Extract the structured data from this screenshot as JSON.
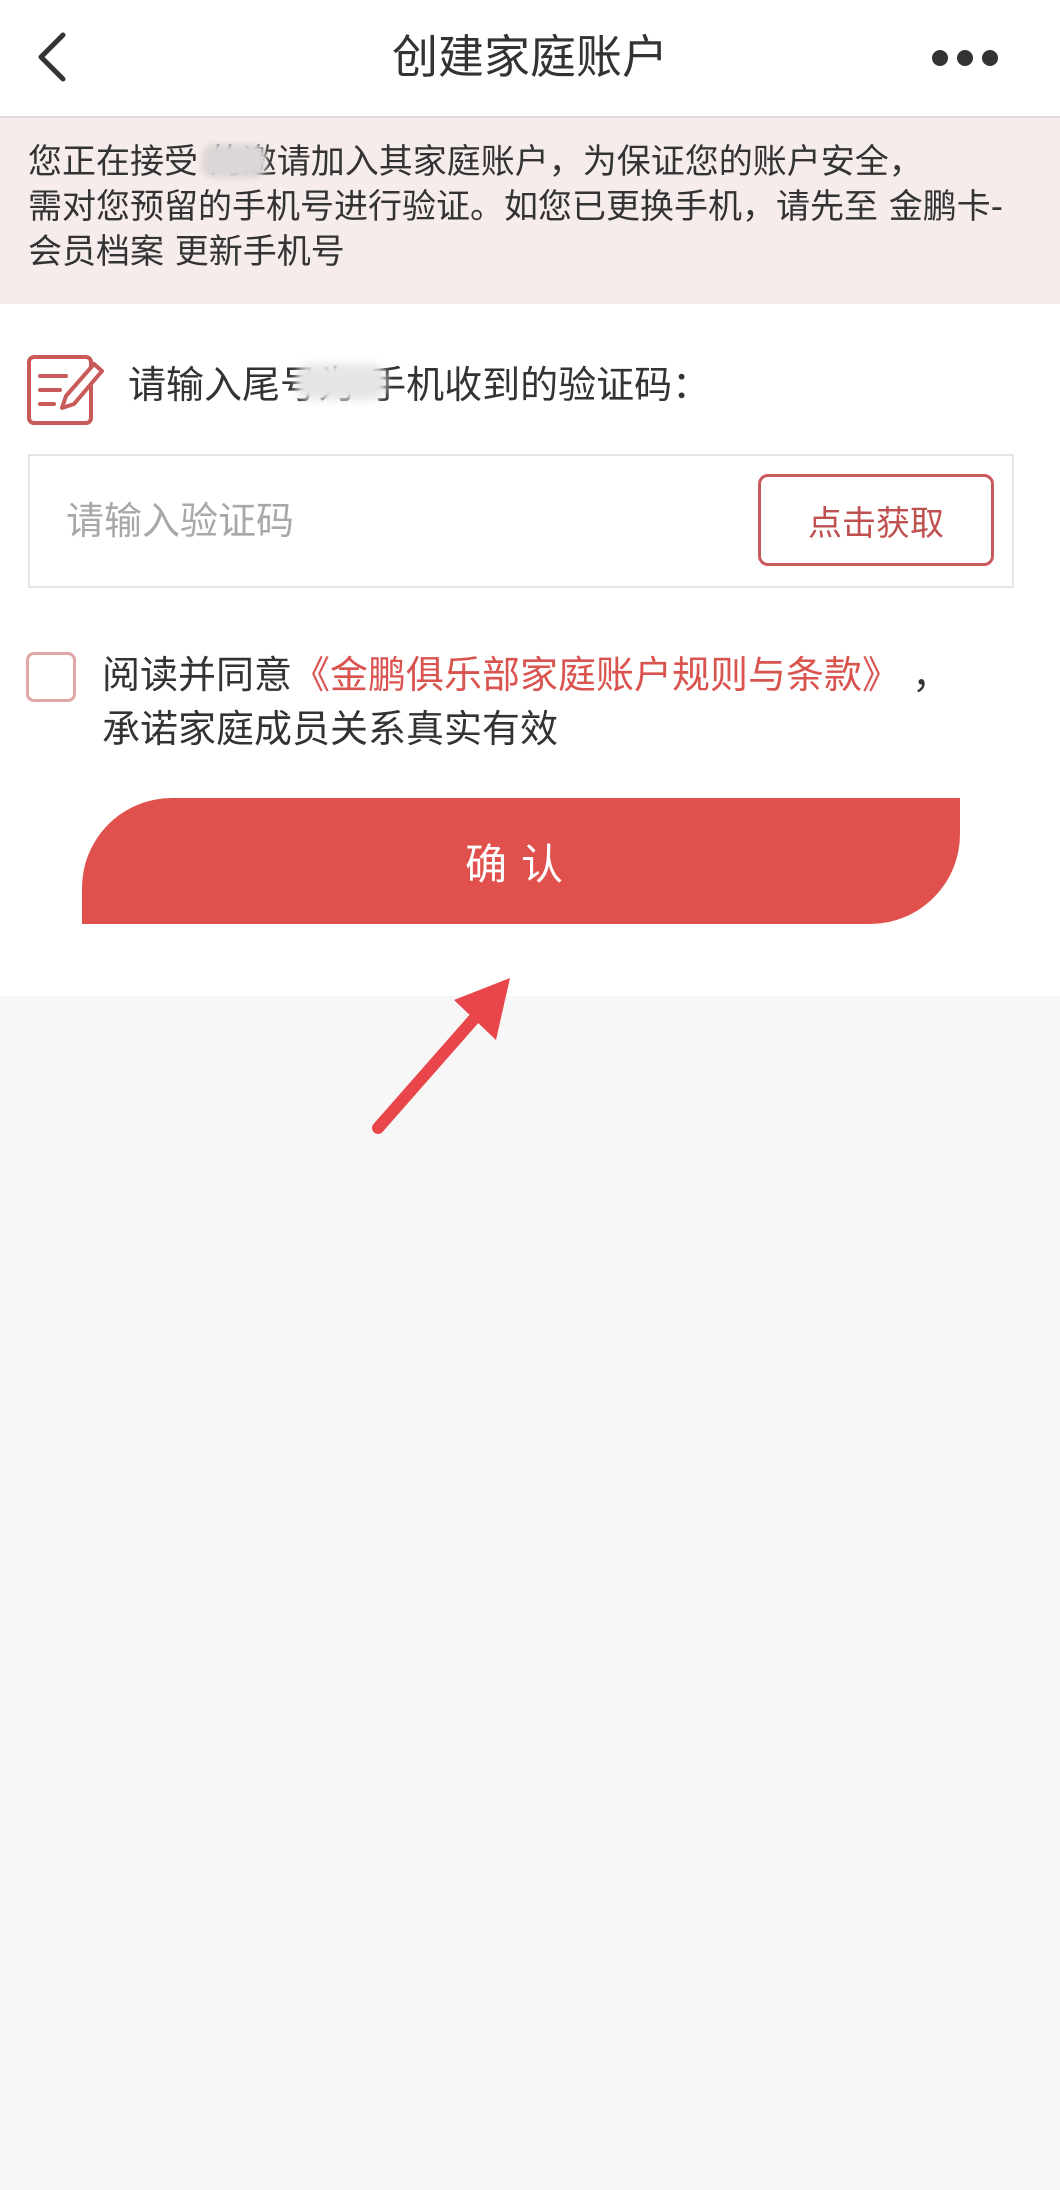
{
  "header": {
    "title": "创建家庭账户"
  },
  "notice": {
    "text": "您正在接受      的邀请加入其家庭账户，为保证您的账户安全，\n需对您预留的手机号进行验证。如您已更换手机，请先至 金鹏卡-\n会员档案 更新手机号"
  },
  "verification": {
    "prompt": "请输入尾号为      手机收到的验证码：",
    "input_placeholder": "请输入验证码",
    "input_value": "",
    "get_code_label": "点击获取"
  },
  "agreement": {
    "prefix": "阅读并同意",
    "terms_link": "《金鹏俱乐部家庭账户规则与条款》",
    "suffix": " ，\n承诺家庭成员关系真实有效",
    "checked": false
  },
  "confirm_button": {
    "label": "确认"
  },
  "colors": {
    "accent": "#e0514e",
    "link": "#d9534f",
    "notice_bg": "#f6eceb",
    "page_bg": "#f7f7f7"
  },
  "icons": {
    "back": "chevron-left-icon",
    "more": "more-dots-icon",
    "edit": "edit-note-icon",
    "pointer": "arrow-pointer-icon"
  }
}
